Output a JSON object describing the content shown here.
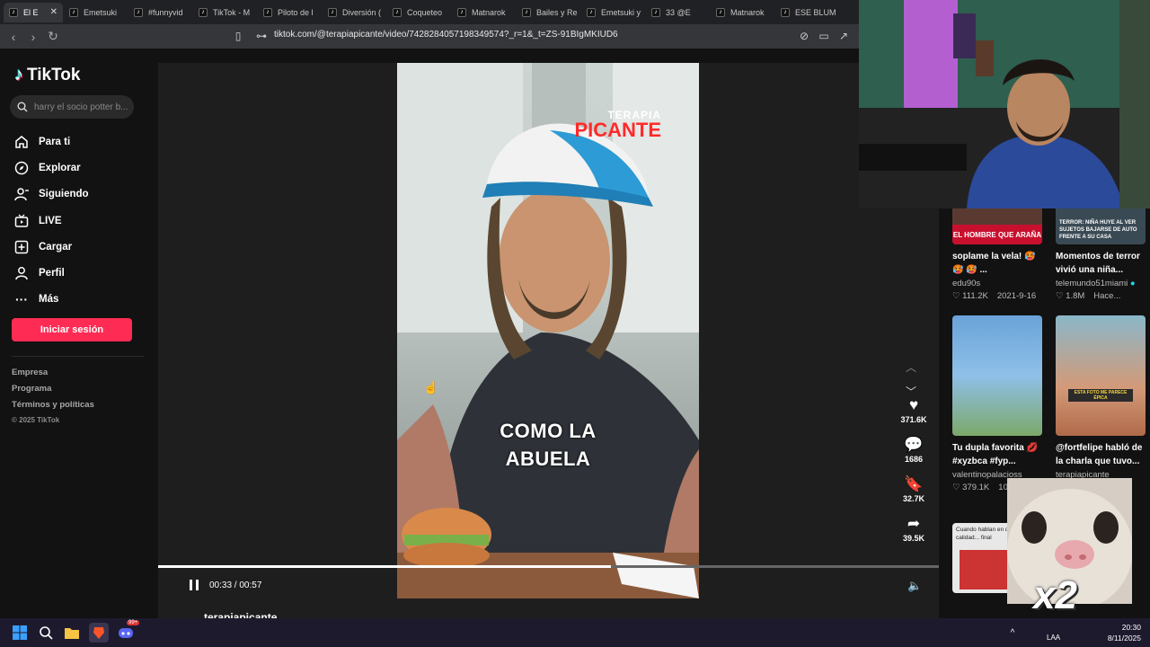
{
  "browser": {
    "tabs": [
      {
        "label": "El E",
        "active": true
      },
      {
        "label": "Emetsuki"
      },
      {
        "label": "#funnyvid"
      },
      {
        "label": "TikTok - M"
      },
      {
        "label": "Piloto de l"
      },
      {
        "label": "Diversión ("
      },
      {
        "label": "Coqueteo"
      },
      {
        "label": "Matnarok"
      },
      {
        "label": "Bailes y Re"
      },
      {
        "label": "Emetsuki y"
      },
      {
        "label": "33 @E"
      },
      {
        "label": "Matnarok"
      },
      {
        "label": "ESE BLUM"
      }
    ],
    "url": "tiktok.com/@terapiapicante/video/7428284057198349574?_r=1&_t=ZS-91BIgMKIUD6"
  },
  "sidebar": {
    "logo": "TikTok",
    "search_placeholder": "harry el socio potter b...",
    "items": [
      {
        "label": "Para ti",
        "icon": "home-icon"
      },
      {
        "label": "Explorar",
        "icon": "compass-icon"
      },
      {
        "label": "Siguiendo",
        "icon": "following-icon"
      },
      {
        "label": "LIVE",
        "icon": "live-icon"
      },
      {
        "label": "Cargar",
        "icon": "upload-icon"
      },
      {
        "label": "Perfil",
        "icon": "profile-icon"
      },
      {
        "label": "Más",
        "icon": "more-icon"
      }
    ],
    "login": "Iniciar sesión",
    "footer": [
      "Empresa",
      "Programa",
      "Términos y políticas"
    ],
    "copyright": "© 2025 TikTok"
  },
  "video": {
    "caption_line1": "COMO LA",
    "caption_line2": "ABUELA",
    "brand_top": "TERAPIA",
    "brand_bottom": "PICANTE",
    "time": "00:33 / 00:57",
    "progress": 0.58,
    "author": "terapiapicante"
  },
  "actions": {
    "likes": "371.6K",
    "comments": "1686",
    "saves": "32.7K",
    "shares": "39.5K"
  },
  "recommendations": [
    {
      "thumb_text": "EL HOMBRE QUE ARAÑA",
      "title1": "soplame la vela! 🥵",
      "title2": "🥵 🥵 ...",
      "user": "edu90s",
      "likes": "111.2K",
      "date": "2021-9-16"
    },
    {
      "thumb_text": "TERROR: NIÑA HUYE AL VER SUJETOS BAJARSE DE AUTO FRENTE A SU CASA",
      "title1": "Momentos de terror",
      "title2": "vivió una niña...",
      "user": "telemundo51miami",
      "likes": "1.8M",
      "date": "Hace..."
    },
    {
      "thumb_text": "",
      "title1": "Tu dupla favorita 💋",
      "title2": "#xyzbca #fyp...",
      "user": "valentinopalacioss",
      "likes": "379.1K",
      "date": "10"
    },
    {
      "thumb_text": "ESTA FOTO ME PARECE ÉPICA",
      "title1": "@fortfelipe habló de",
      "title2": "la charla que tuvo...",
      "user": "terapiapicante",
      "likes": "",
      "date": "4"
    },
    {
      "thumb_text": "Cuando hablan en de calidad... final",
      "title1": "",
      "title2": "",
      "user": "",
      "likes": "",
      "date": ""
    }
  ],
  "overlay": {
    "multiplier": "x2"
  },
  "taskbar": {
    "time": "20:30",
    "date": "8/11/2025",
    "lang": "LAA",
    "badge": "99+"
  }
}
